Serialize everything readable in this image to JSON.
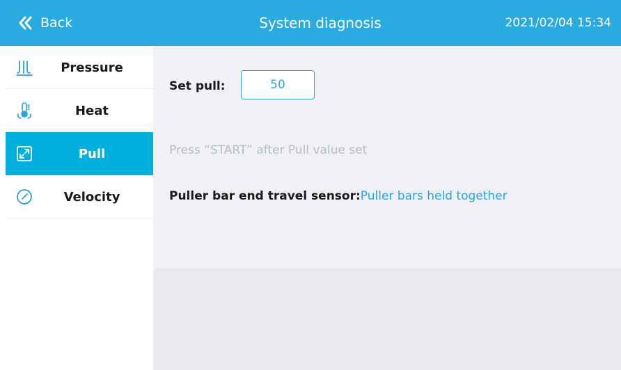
{
  "header": {
    "back_label": "Back",
    "title": "System diagnosis",
    "datetime": "2021/02/04  15:34"
  },
  "sidebar": {
    "items": [
      {
        "label": "Pressure",
        "icon": "pressure-icon",
        "active": false
      },
      {
        "label": "Heat",
        "icon": "thermometer-icon",
        "active": false
      },
      {
        "label": "Pull",
        "icon": "expand-arrows-icon",
        "active": true
      },
      {
        "label": "Velocity",
        "icon": "gauge-icon",
        "active": false
      }
    ]
  },
  "main": {
    "set_pull_label": "Set pull:",
    "set_pull_value": "50",
    "hint": "Press “START” after Pull value set",
    "sensor_label": "Puller bar end travel sensor:",
    "sensor_value": "Puller bars held together"
  },
  "colors": {
    "header_bg": "#29abe2",
    "active_item_bg": "#00b0de",
    "accent": "#2aa3dc",
    "panel_bg": "#eff1f5",
    "hint_text": "#b8bcc2"
  }
}
